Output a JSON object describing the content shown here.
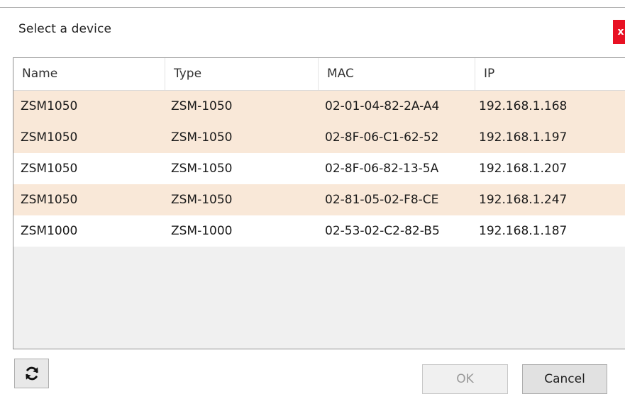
{
  "window": {
    "title": "Select a device",
    "close_label": "x"
  },
  "table": {
    "columns": [
      "Name",
      "Type",
      "MAC",
      "IP"
    ],
    "rows": [
      {
        "name": "ZSM1050",
        "type": "ZSM-1050",
        "mac": "02-01-04-82-2A-A4",
        "ip": "192.168.1.168"
      },
      {
        "name": "ZSM1050",
        "type": "ZSM-1050",
        "mac": "02-8F-06-C1-62-52",
        "ip": "192.168.1.197"
      },
      {
        "name": "ZSM1050",
        "type": "ZSM-1050",
        "mac": "02-8F-06-82-13-5A",
        "ip": "192.168.1.207"
      },
      {
        "name": "ZSM1050",
        "type": "ZSM-1050",
        "mac": "02-81-05-02-F8-CE",
        "ip": "192.168.1.247"
      },
      {
        "name": "ZSM1000",
        "type": "ZSM-1000",
        "mac": "02-53-02-C2-82-B5",
        "ip": "192.168.1.187"
      }
    ]
  },
  "buttons": {
    "refresh_icon": "refresh-icon",
    "ok_label": "OK",
    "cancel_label": "Cancel"
  },
  "colors": {
    "row_highlight": "#f9e8d8",
    "close_red": "#e81123"
  }
}
